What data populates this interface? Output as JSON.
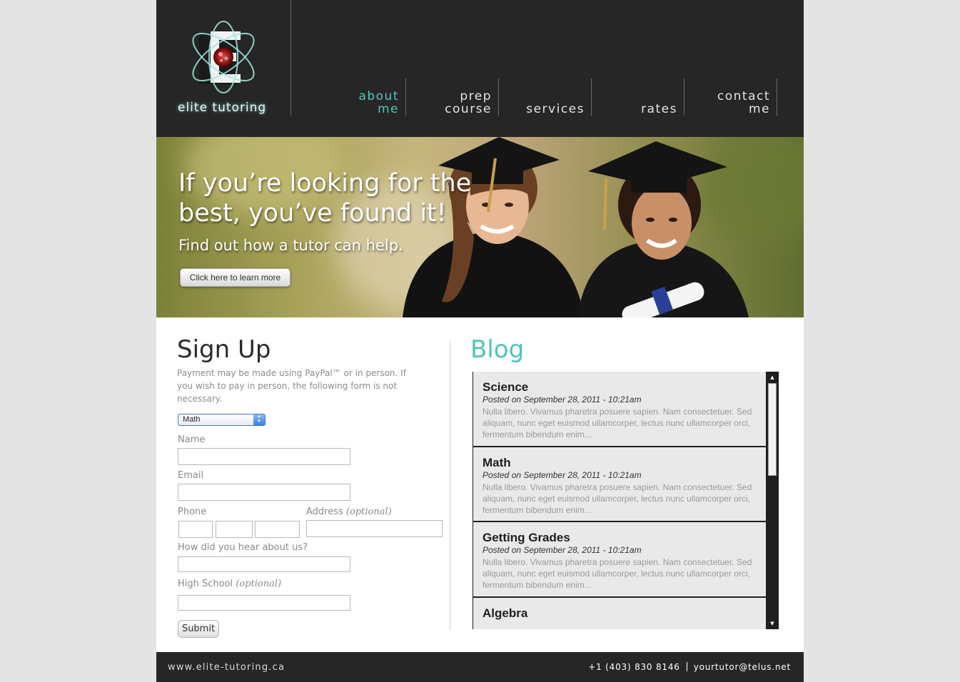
{
  "site": {
    "logo_text": "elite tutoring"
  },
  "nav": {
    "items": [
      {
        "label": "about\nme",
        "active": true
      },
      {
        "label": "prep\ncourse",
        "active": false
      },
      {
        "label": "services",
        "active": false
      },
      {
        "label": "rates",
        "active": false
      },
      {
        "label": "contact\nme",
        "active": false
      }
    ]
  },
  "hero": {
    "title": "If you’re looking for the best, you’ve found it!",
    "subtitle": "Find out how a tutor can help.",
    "button_label": "Click here to learn more"
  },
  "signup": {
    "title": "Sign Up",
    "note": "Payment may be made using PayPal™ or in person. If you wish to pay in person, the following form is not necessary.",
    "subject_select": "Math",
    "name_label": "Name",
    "email_label": "Email",
    "phone_label": "Phone",
    "address_label": "Address",
    "address_optional": "(optional)",
    "hear_label": "How did you hear about us?",
    "school_label": "High School",
    "school_optional": "(optional)",
    "submit_label": "Submit"
  },
  "blog": {
    "title": "Blog",
    "posts": [
      {
        "title": "Science",
        "meta": "Posted on September 28, 2011 - 10:21am",
        "excerpt": "Nulla libero. Vivamus pharetra posuere sapien. Nam consectetuer. Sed aliquam, nunc eget euismod ullamcorper, lectus nunc ullamcorper orci, fermentum bibendum enim..."
      },
      {
        "title": "Math",
        "meta": "Posted on September 28, 2011 - 10:21am",
        "excerpt": "Nulla libero. Vivamus pharetra posuere sapien. Nam consectetuer. Sed aliquam, nunc eget euismod ullamcorper, lectus nunc ullamcorper orci, fermentum bibendum enim..."
      },
      {
        "title": "Getting Grades",
        "meta": "Posted on September 28, 2011 - 10:21am",
        "excerpt": "Nulla libero. Vivamus pharetra posuere sapien. Nam consectetuer. Sed aliquam, nunc eget euismod ullamcorper, lectus nunc ullamcorper orci, fermentum bibendum enim..."
      },
      {
        "title": "Algebra",
        "meta": "",
        "excerpt": ""
      }
    ]
  },
  "footer": {
    "site": "www.elite-tutoring.ca",
    "phone": "+1 (403) 830 8146",
    "email": "yourtutor@telus.net"
  },
  "colors": {
    "accent": "#53c4b6",
    "header_bg": "#262626"
  },
  "icons": {
    "logo": "atom-e-logo-icon",
    "select_arrows": "select-arrows-icon",
    "scroll_up": "scroll-up-icon",
    "scroll_down": "scroll-down-icon"
  }
}
